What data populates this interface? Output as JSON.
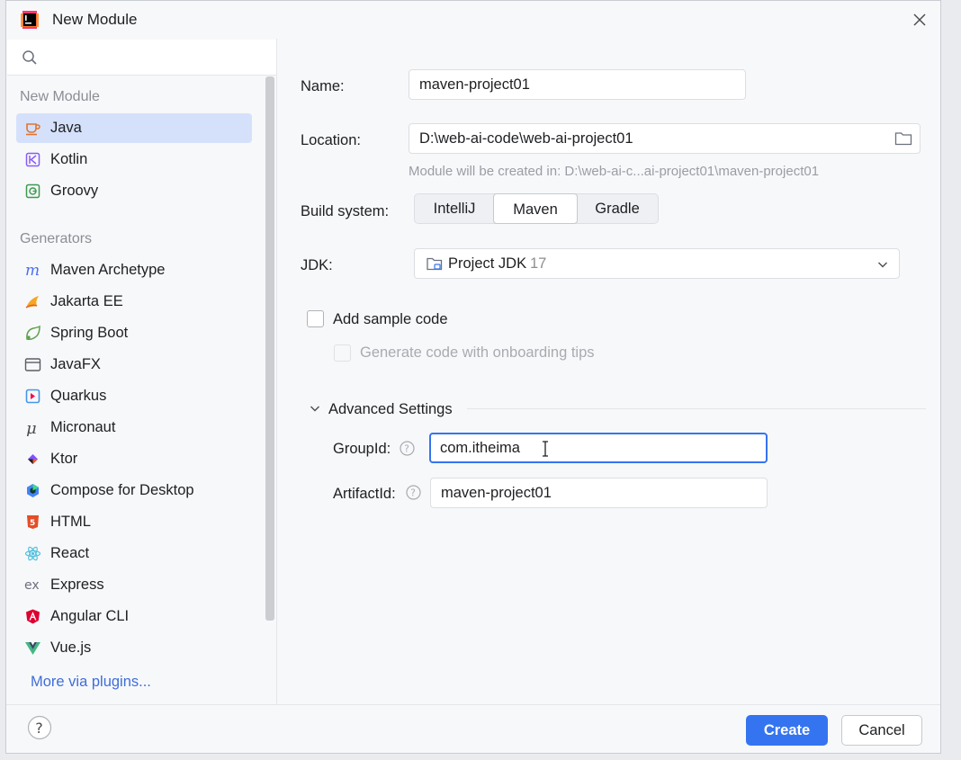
{
  "window": {
    "title": "New Module"
  },
  "search": {
    "placeholder": ""
  },
  "sidebar": {
    "section_new_module": "New Module",
    "new_module_items": [
      {
        "label": "Java",
        "icon": "java-icon",
        "selected": true
      },
      {
        "label": "Kotlin",
        "icon": "kotlin-icon"
      },
      {
        "label": "Groovy",
        "icon": "groovy-icon"
      }
    ],
    "section_generators": "Generators",
    "generator_items": [
      {
        "label": "Maven Archetype",
        "icon": "maven-icon"
      },
      {
        "label": "Jakarta EE",
        "icon": "jakarta-icon"
      },
      {
        "label": "Spring Boot",
        "icon": "spring-icon"
      },
      {
        "label": "JavaFX",
        "icon": "javafx-icon"
      },
      {
        "label": "Quarkus",
        "icon": "quarkus-icon"
      },
      {
        "label": "Micronaut",
        "icon": "micronaut-icon"
      },
      {
        "label": "Ktor",
        "icon": "ktor-icon"
      },
      {
        "label": "Compose for Desktop",
        "icon": "compose-icon"
      },
      {
        "label": "HTML",
        "icon": "html-icon"
      },
      {
        "label": "React",
        "icon": "react-icon"
      },
      {
        "label": "Express",
        "icon": "express-icon"
      },
      {
        "label": "Angular CLI",
        "icon": "angular-icon"
      },
      {
        "label": "Vue.js",
        "icon": "vue-icon"
      }
    ],
    "more_plugins": "More via plugins..."
  },
  "form": {
    "name_label": "Name:",
    "name_value": "maven-project01",
    "location_label": "Location:",
    "location_value": "D:\\web-ai-code\\web-ai-project01",
    "location_hint": "Module will be created in: D:\\web-ai-c...ai-project01\\maven-project01",
    "build_label": "Build system:",
    "build_options": [
      "IntelliJ",
      "Maven",
      "Gradle"
    ],
    "build_selected": "Maven",
    "jdk_label": "JDK:",
    "jdk_value": "Project JDK",
    "jdk_version": "17",
    "sample_code_label": "Add sample code",
    "onboarding_label": "Generate code with onboarding tips",
    "advanced_label": "Advanced Settings",
    "groupid_label": "GroupId:",
    "groupid_value": "com.itheima",
    "artifactid_label": "ArtifactId:",
    "artifactid_value": "maven-project01"
  },
  "footer": {
    "help": "?",
    "create_label": "Create",
    "cancel_label": "Cancel"
  },
  "colors": {
    "accent": "#3574f0",
    "selected_bg": "#d5e1fb",
    "link": "#3f6ed8"
  }
}
